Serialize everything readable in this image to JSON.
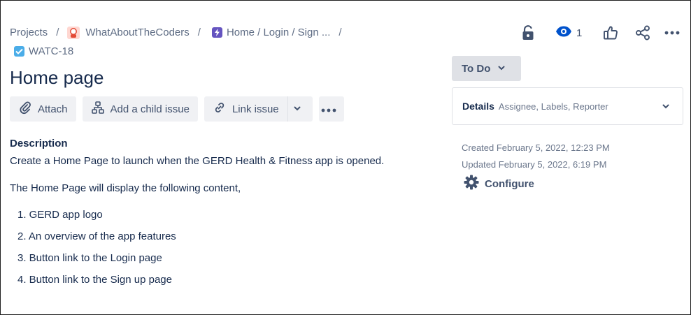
{
  "breadcrumb": {
    "projects": "Projects",
    "project_name": "WhatAboutTheCoders",
    "epic": "Home / Login / Sign ...",
    "issue_key": "WATC-18",
    "separator": "/"
  },
  "issue": {
    "title": "Home page"
  },
  "toolbar": {
    "attach": "Attach",
    "add_child": "Add a child issue",
    "link_issue": "Link issue"
  },
  "watchers": {
    "count": "1"
  },
  "status": {
    "label": "To Do"
  },
  "details": {
    "title": "Details",
    "summary": "Assignee, Labels, Reporter"
  },
  "meta": {
    "created": "Created February 5, 2022, 12:23 PM",
    "updated": "Updated February 5, 2022, 6:19 PM",
    "configure": "Configure"
  },
  "description": {
    "heading": "Description",
    "paragraph1": "Create a Home Page to launch when the GERD Health & Fitness app is opened.",
    "paragraph2": "The Home Page will display the following content,",
    "items": [
      "1. GERD app logo",
      "2. An overview of the app features",
      "3. Button link to the Login page",
      "4. Button link to the Sign up page"
    ]
  },
  "colors": {
    "text": "#172b4d",
    "subtle": "#5e6c84",
    "button_bg": "#f0f1f4",
    "status_bg": "#dfe1e6",
    "epic": "#6554c0",
    "task": "#4bade8",
    "watch": "#0052cc"
  },
  "icons": [
    "avatar",
    "epic-icon",
    "task-icon",
    "lock-icon",
    "eye-icon",
    "thumbs-up-icon",
    "share-icon",
    "more-icon",
    "paperclip-icon",
    "hierarchy-icon",
    "link-icon",
    "chevron-down-icon",
    "gear-icon"
  ]
}
